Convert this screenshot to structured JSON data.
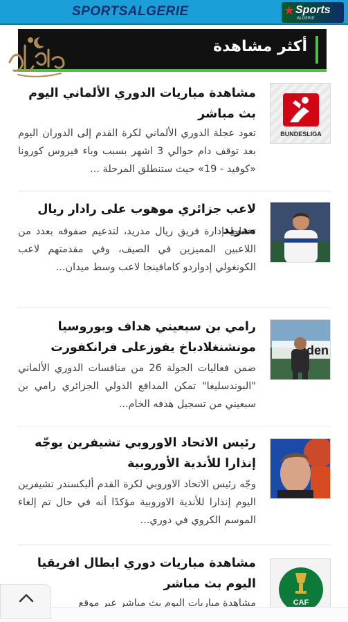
{
  "site": {
    "brand": "SPORTSALGERIE",
    "sports_logo_text": "Sports",
    "sports_logo_sub": "ALGERIE"
  },
  "section": {
    "title": "أكثر مشاهدة"
  },
  "articles": [
    {
      "title": "مشاهدة مباريات الدوري الألماني اليوم بث مباشر",
      "excerpt": "تعود عجلة الدوري الألماني لكرة القدم إلى الدوران اليوم بعد توقف دام حوالي 3 اشهر بسبب وباء فيروس كورونا «كوفيد - 19» حيث ستنطلق المرحلة ...",
      "thumb_label": "BUNDESLIGA",
      "thumb_icon": "bundesliga-logo"
    },
    {
      "title": "لاعب جزائري موهوب على رادار ريال مدريد",
      "excerpt": "تخطط إدارة فريق ريال مدريد، لتدعيم صفوفه بعدد من اللاعبين المميزين في الصيف، وفي مقدمتهم لاعب الكونغولي إدواردو كامافينجا لاعب وسط ميدان...",
      "thumb_icon": "player-photo"
    },
    {
      "title": "رامي بن سبعيني هداف وبوروسيا مونشنغلادباخ يفوزعلى فرانكفورت",
      "excerpt": "ضمن فعاليات الجولة 26 من منافسات الدوري الألماني \"البوندسليغا\" تمكن المدافع الدولي الجزائري رامي بن سبعيني من تسجيل هدفه الخام...",
      "thumb_text": "iden",
      "thumb_icon": "player-photo"
    },
    {
      "title": "رئيس الاتحاد الاوروبي تشيفرين يوجّه إنذارا للأندية الأوروبية",
      "excerpt": "وجّه رئيس الاتحاد الاوروبي لكرة القدم ألبكسندر تشيفرين اليوم إنذارا للأندية الاوروبية مؤكدًا أنه في حال تم إلغاء الموسم الكروي في دوري...",
      "thumb_icon": "portrait-photo"
    },
    {
      "title": "مشاهدة مباريات دوري ابطال افريقيا اليوم بث مباشر",
      "excerpt": "مشاهدة مباريات اليوم بث مباشر عبر موقع",
      "thumb_label": "CAF",
      "thumb_icon": "caf-champions-league-logo"
    }
  ],
  "controls": {
    "scroll_top_icon": "chevron-up-icon"
  },
  "colors": {
    "topbar": "#1a9fd8",
    "brand_text": "#0b2f6b",
    "header_bg": "#111111",
    "accent_green": "#4fc146"
  }
}
